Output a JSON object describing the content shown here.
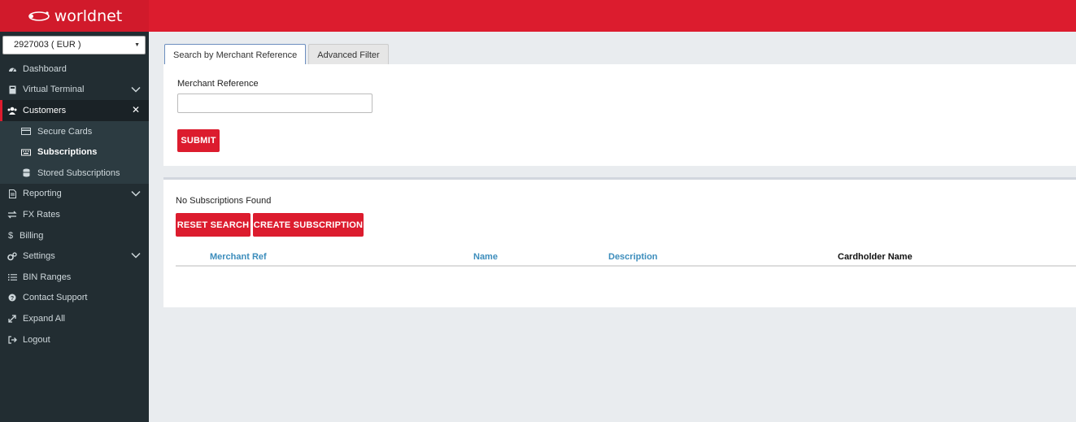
{
  "brand": {
    "name": "worldnet"
  },
  "merchant_select": {
    "value": "2927003 ( EUR )"
  },
  "sidebar": {
    "items": [
      {
        "label": "Dashboard",
        "icon": "dashboard-icon"
      },
      {
        "label": "Virtual Terminal",
        "icon": "calculator-icon"
      },
      {
        "label": "Customers",
        "icon": "users-icon"
      },
      {
        "label": "Reporting",
        "icon": "report-icon"
      },
      {
        "label": "FX Rates",
        "icon": "exchange-icon"
      },
      {
        "label": "Billing",
        "icon": "dollar-icon"
      },
      {
        "label": "Settings",
        "icon": "cogs-icon"
      },
      {
        "label": "BIN Ranges",
        "icon": "list-icon"
      },
      {
        "label": "Contact Support",
        "icon": "question-icon"
      },
      {
        "label": "Expand All",
        "icon": "expand-icon"
      },
      {
        "label": "Logout",
        "icon": "logout-icon"
      }
    ],
    "customers_sub": [
      {
        "label": "Secure Cards",
        "icon": "credit-card-icon"
      },
      {
        "label": "Subscriptions",
        "icon": "keyboard-icon"
      },
      {
        "label": "Stored Subscriptions",
        "icon": "database-icon"
      }
    ]
  },
  "tabs": [
    {
      "label": "Search by Merchant Reference"
    },
    {
      "label": "Advanced Filter"
    }
  ],
  "search": {
    "field_label": "Merchant Reference",
    "value": "",
    "submit_label": "SUBMIT"
  },
  "results": {
    "status": "No Subscriptions Found",
    "reset_label": "RESET SEARCH",
    "create_label": "CREATE SUBSCRIPTION",
    "columns": [
      "Merchant Ref",
      "Name",
      "Description",
      "Cardholder Name"
    ]
  },
  "colors": {
    "brand_red": "#dc1c2e",
    "sidebar_bg": "#222d32",
    "link_blue": "#3c8dbc"
  }
}
